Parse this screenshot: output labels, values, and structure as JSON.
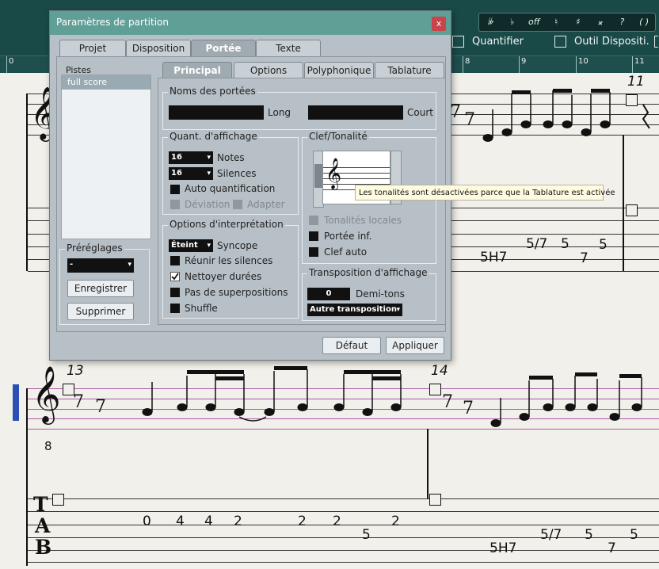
{
  "toolbar": {
    "accidentals": [
      "𝄫",
      "♭",
      "off",
      "♮",
      "♯",
      "𝄪",
      "?",
      "( )"
    ],
    "quantify_label": "Quantifier",
    "tool_label": "Outil Dispositi."
  },
  "ruler": {
    "numbers": [
      "0",
      "8",
      "9",
      "10",
      "11"
    ]
  },
  "dialog": {
    "title": "Paramètres de partition",
    "close_glyph": "x",
    "tabs": [
      "Projet",
      "Disposition",
      "Portée",
      "Texte"
    ],
    "active_tab": "Portée",
    "subtabs": [
      "Principal",
      "Options",
      "Polyphonique",
      "Tablature"
    ],
    "active_subtab": "Principal",
    "tracks_label": "Pistes",
    "tracks": [
      "full score"
    ],
    "presets": {
      "label": "Préréglages",
      "selected": "-",
      "save_button": "Enregistrer",
      "delete_button": "Supprimer"
    },
    "staff_names": {
      "label": "Noms des portées",
      "long_label": "Long",
      "short_label": "Court"
    },
    "display_quant": {
      "label": "Quant. d'affichage",
      "notes_value": "16",
      "notes_label": "Notes",
      "rests_value": "16",
      "rests_label": "Silences",
      "auto_quant": "Auto quantification",
      "deviation": "Déviation",
      "adapt": "Adapter"
    },
    "interpretation": {
      "label": "Options d'interprétation",
      "syncope_value": "Éteint",
      "syncope_label": "Syncope",
      "merge_rests": "Réunir les silences",
      "clean_durations": "Nettoyer durées",
      "no_overlaps": "Pas de superpositions",
      "shuffle": "Shuffle"
    },
    "clef_key": {
      "label": "Clef/Tonalité",
      "local_keys": "Tonalités locales",
      "lower_staff": "Portée inf.",
      "auto_clef": "Clef auto"
    },
    "transposition": {
      "label": "Transposition d'affichage",
      "semitones_value": "0",
      "semitones_label": "Demi-tons",
      "preset": "Autre transposition"
    },
    "default_button": "Défaut",
    "apply_button": "Appliquer",
    "tooltip": "Les tonalités sont désactivées parce que la Tablature est activée"
  },
  "score": {
    "measure_numbers": [
      "11",
      "13",
      "14"
    ],
    "clef_octave": "8",
    "tab_letters": [
      "T",
      "A",
      "B"
    ],
    "tab_top_row1": [
      "5/7",
      "5"
    ],
    "tab_top_row2": [
      "5H7",
      "7",
      "5"
    ],
    "tab_bottom_row1": [
      "0",
      "4",
      "4",
      "2",
      "2",
      "2",
      "2"
    ],
    "tab_bottom_row2": [
      "5"
    ],
    "tab_bottom_row3": [
      "5/7",
      "5",
      "5"
    ],
    "tab_bottom_row4": [
      "5H7",
      "7"
    ]
  }
}
